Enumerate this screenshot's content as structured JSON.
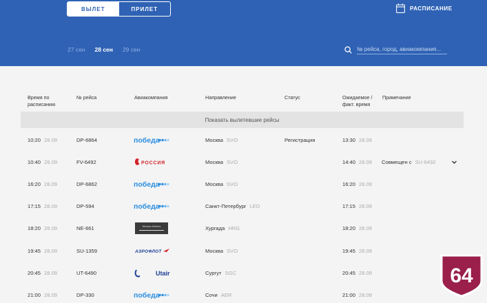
{
  "header": {
    "tabs": [
      {
        "label": "ВЫЛЕТ",
        "active": true
      },
      {
        "label": "ПРИЛЕТ",
        "active": false
      }
    ],
    "schedule_label": "РАСПИСАНИЕ",
    "dates": [
      {
        "label": "27 сен",
        "active": false
      },
      {
        "label": "28 сен",
        "active": true
      },
      {
        "label": "29 сен",
        "active": false
      }
    ],
    "search_placeholder": "№ рейса, город, авиакомпания..."
  },
  "table": {
    "columns": [
      "Время по\nрасписанию",
      "№ рейса",
      "Авиакомпания",
      "Направление",
      "Статус",
      "Ожидаемое /\nфакт. время",
      "Примечание"
    ],
    "show_departed_label": "Показать вылетевшие рейсы",
    "rows": [
      {
        "time": "10:20",
        "date": "28.09",
        "flight": "DP-6864",
        "airline": "pobeda",
        "airline_text": "победа",
        "city": "Москва",
        "code": "SVO",
        "status": "Регистрация",
        "exp_time": "13:30",
        "exp_date": "28.09",
        "note": "",
        "expandable": false
      },
      {
        "time": "10:40",
        "date": "28.09",
        "flight": "FV-6492",
        "airline": "rossiya",
        "airline_text": "РОССИЯ",
        "city": "Москва",
        "code": "SVO",
        "status": "",
        "exp_time": "14:40",
        "exp_date": "28.09",
        "note": "Совмещен с SU-6492",
        "expandable": true
      },
      {
        "time": "16:20",
        "date": "28.09",
        "flight": "DP-6862",
        "airline": "pobeda",
        "airline_text": "победа",
        "city": "Москва",
        "code": "SVO",
        "status": "",
        "exp_time": "16:20",
        "exp_date": "28.09",
        "note": "",
        "expandable": false
      },
      {
        "time": "17:15",
        "date": "28.09",
        "flight": "DP-594",
        "airline": "pobeda",
        "airline_text": "победа",
        "city": "Санкт-Петербург",
        "code": "LED",
        "status": "",
        "exp_time": "17:15",
        "exp_date": "28.09",
        "note": "",
        "expandable": false
      },
      {
        "time": "18:20",
        "date": "28.09",
        "flight": "NE-661",
        "airline": "nesma",
        "airline_text": "Nesma Airlines",
        "city": "Хургада",
        "code": "HRG",
        "status": "",
        "exp_time": "18:20",
        "exp_date": "28.09",
        "note": "",
        "expandable": false
      },
      {
        "time": "19:45",
        "date": "28.09",
        "flight": "SU-1359",
        "airline": "aeroflot",
        "airline_text": "АЭРОФЛОТ",
        "city": "Москва",
        "code": "SVO",
        "status": "",
        "exp_time": "19:45",
        "exp_date": "28.09",
        "note": "",
        "expandable": false
      },
      {
        "time": "20:45",
        "date": "28.09",
        "flight": "UT-6490",
        "airline": "utair",
        "airline_text": "Utair",
        "city": "Сургут",
        "code": "SGC",
        "status": "",
        "exp_time": "20:45",
        "exp_date": "28.09",
        "note": "",
        "expandable": false
      },
      {
        "time": "21:00",
        "date": "28.09",
        "flight": "DP-330",
        "airline": "pobeda",
        "airline_text": "победа",
        "city": "Сочи",
        "code": "AER",
        "status": "",
        "exp_time": "21:00",
        "exp_date": "28.09",
        "note": "",
        "expandable": false
      }
    ]
  },
  "badge_text": "64",
  "colors": {
    "header_bg": "#2f62b4",
    "pobeda": "#2b8ee0",
    "rossiya_red": "#d2232a",
    "aeroflot_blue": "#1c3f94",
    "badge": "#9a1f4b"
  }
}
